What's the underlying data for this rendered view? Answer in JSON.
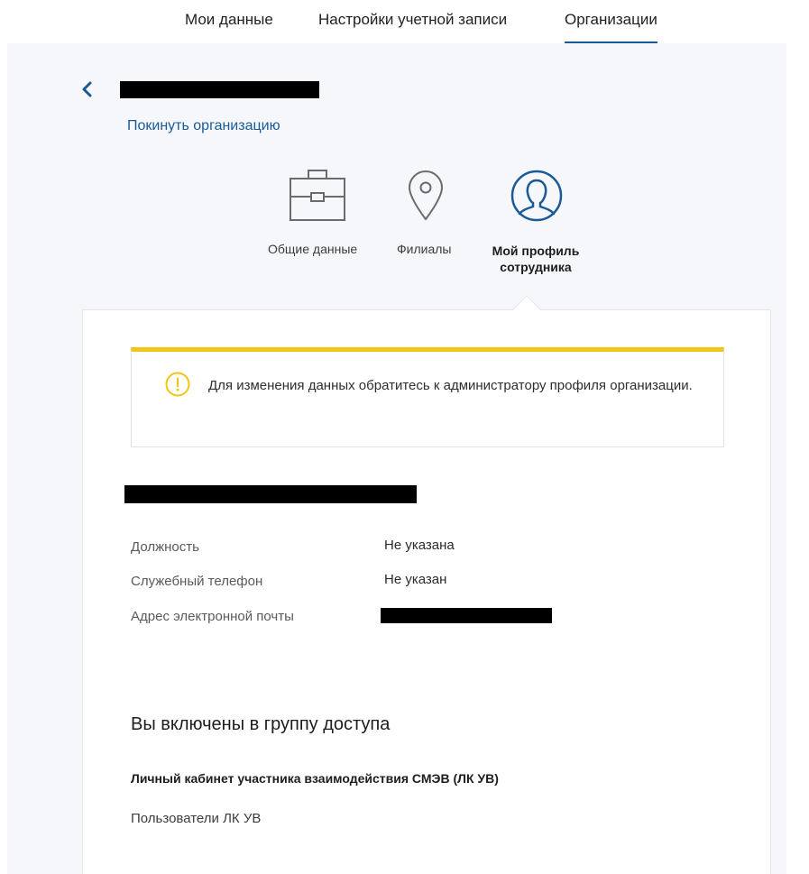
{
  "topnav": {
    "tabs": [
      {
        "label": "Мои данные",
        "active": false
      },
      {
        "label": "Настройки учетной записи",
        "active": false
      },
      {
        "label": "Организации",
        "active": true
      }
    ]
  },
  "org": {
    "leave_link": "Покинуть организацию"
  },
  "sections": {
    "general": "Общие данные",
    "branches": "Филиалы",
    "profile_line1": "Мой профиль",
    "profile_line2": "сотрудника"
  },
  "notice": {
    "text": "Для изменения данных обратитесь к администратору профиля организации."
  },
  "profile": {
    "fields": [
      {
        "label": "Должность",
        "value": "Не указана"
      },
      {
        "label": "Служебный телефон",
        "value": "Не указан"
      },
      {
        "label": "Адрес электронной почты",
        "value": ""
      }
    ]
  },
  "access": {
    "title": "Вы включены в группу доступа",
    "group_name": "Личный кабинет участника взаимодействия СМЭВ (ЛК УВ)",
    "group_role": "Пользователи ЛК УВ"
  },
  "colors": {
    "accent": "#1a5a96",
    "warning": "#f0c514",
    "background": "#f5f7fa"
  },
  "icons": [
    "chevron-left-icon",
    "briefcase-icon",
    "map-pin-icon",
    "user-circle-icon",
    "warning-icon"
  ]
}
